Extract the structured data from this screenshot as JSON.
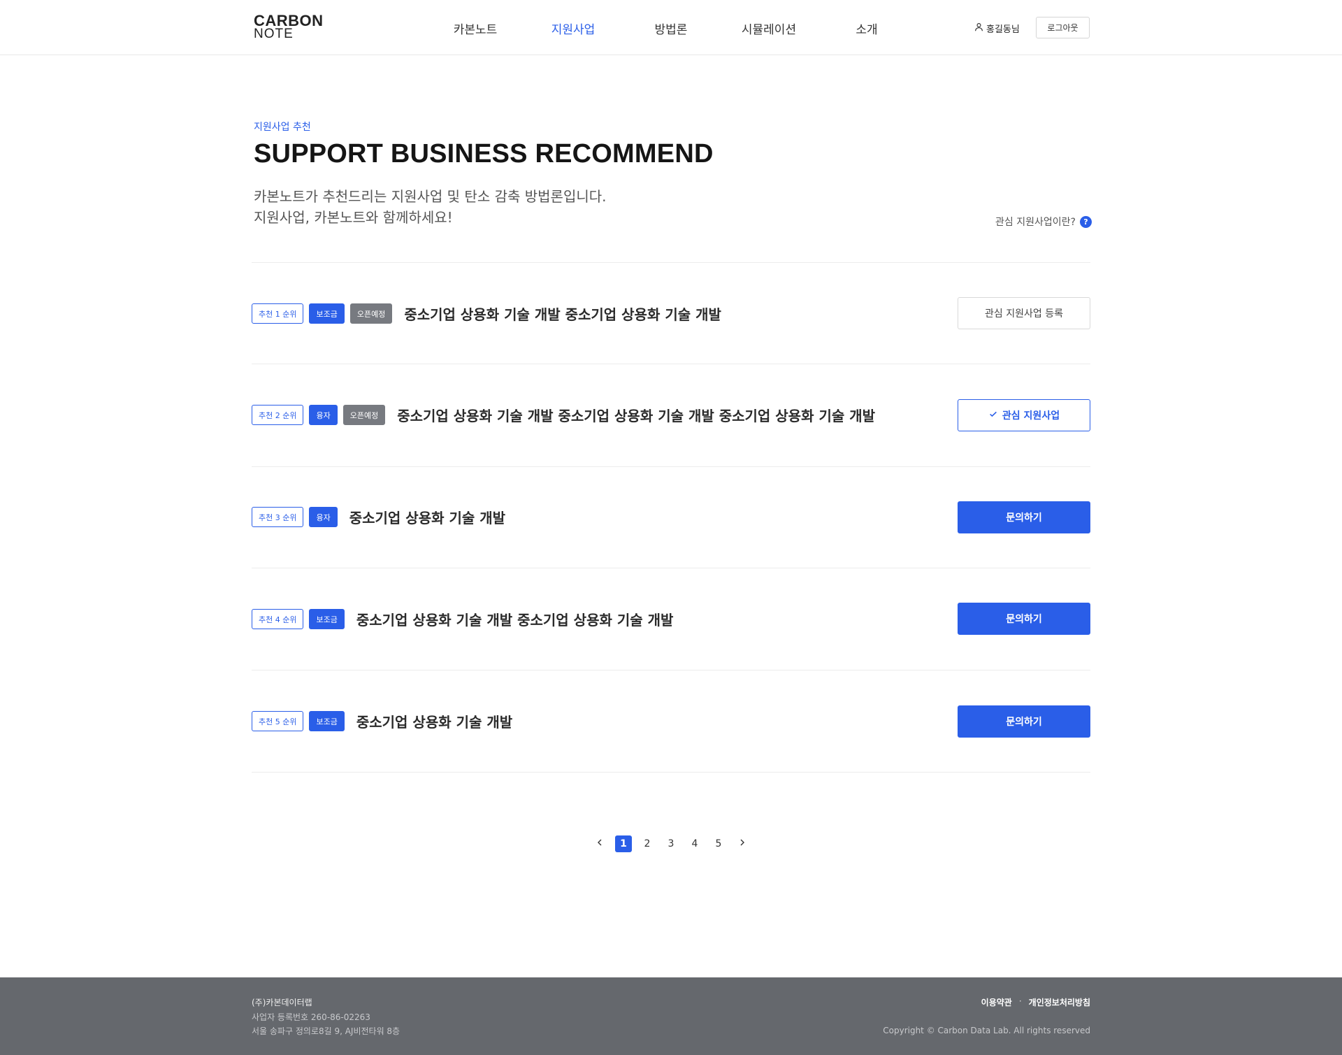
{
  "header": {
    "logo_line1": "CARBON",
    "logo_line2": "NOTE",
    "nav": [
      {
        "label": "카본노트",
        "active": false
      },
      {
        "label": "지원사업",
        "active": true
      },
      {
        "label": "방법론",
        "active": false
      },
      {
        "label": "시뮬레이션",
        "active": false
      },
      {
        "label": "소개",
        "active": false
      }
    ],
    "user_name": "홍길동님",
    "logout_label": "로그아웃"
  },
  "hero": {
    "eyebrow": "지원사업 추천",
    "title": "SUPPORT BUSINESS RECOMMEND",
    "desc_line1": "카본노트가 추천드리는 지원사업 및 탄소 감축 방법론입니다.",
    "desc_line2": "지원사업, 카본노트와 함께하세요!",
    "help_label": "관심 지원사업이란?",
    "help_icon": "question-icon"
  },
  "list": [
    {
      "rank": "추천 1 순위",
      "type": "보조금",
      "status": "오픈예정",
      "title": "중소기업 상용화 기술 개발 중소기업 상용화 기술 개발",
      "action": "관심 지원사업 등록",
      "action_style": "outline-gray"
    },
    {
      "rank": "추천 2 순위",
      "type": "융자",
      "status": "오픈예정",
      "title": "중소기업 상용화 기술 개발 중소기업 상용화 기술 개발 중소기업 상용화 기술 개발",
      "action": "관심 지원사업",
      "action_style": "outline-blue"
    },
    {
      "rank": "추천 3 순위",
      "type": "융자",
      "status": "",
      "title": "중소기업 상용화 기술 개발",
      "action": "문의하기",
      "action_style": "solid"
    },
    {
      "rank": "추천 4 순위",
      "type": "보조금",
      "status": "",
      "title": "중소기업 상용화 기술 개발 중소기업 상용화 기술 개발",
      "action": "문의하기",
      "action_style": "solid"
    },
    {
      "rank": "추천 5 순위",
      "type": "보조금",
      "status": "",
      "title": "중소기업 상용화 기술 개발",
      "action": "문의하기",
      "action_style": "solid"
    }
  ],
  "pagination": {
    "pages": [
      "1",
      "2",
      "3",
      "4",
      "5"
    ],
    "current": "1"
  },
  "footer": {
    "company": "(주)카본데이터랩",
    "reg": "사업자 등록번호 260-86-02263",
    "address": "서울 송파구 정의로8길 9, AJ비전타워 8층",
    "terms": "이용약관",
    "separator": "·",
    "privacy": "개인정보처리방침",
    "copyright": "Copyright © Carbon Data Lab. All rights reserved"
  },
  "colors": {
    "accent": "#2a5ee8",
    "status_gray": "#777a80",
    "footer_bg": "#65686d"
  }
}
